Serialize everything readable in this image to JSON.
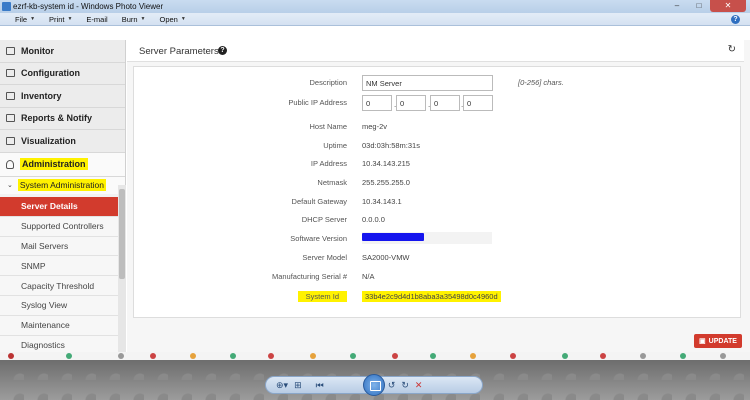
{
  "window": {
    "title": "ezrf-kb-system id - Windows Photo Viewer",
    "controls": [
      "–",
      "□",
      "✕"
    ]
  },
  "menubar": {
    "items": [
      {
        "label": "File",
        "caret": true
      },
      {
        "label": "Print",
        "caret": true
      },
      {
        "label": "E-mail",
        "caret": false
      },
      {
        "label": "Burn",
        "caret": true
      },
      {
        "label": "Open",
        "caret": true
      }
    ],
    "help_icon": "?"
  },
  "sidebar": {
    "items": [
      {
        "label": "Monitor",
        "icon": "monitor-icon"
      },
      {
        "label": "Configuration",
        "icon": "folder-icon"
      },
      {
        "label": "Inventory",
        "icon": "folder-icon"
      },
      {
        "label": "Reports & Notify",
        "icon": "folder-icon"
      },
      {
        "label": "Visualization",
        "icon": "monitor-icon"
      }
    ],
    "administration": {
      "label": "Administration",
      "icon": "person-icon"
    },
    "system_administration": {
      "label": "System Administration",
      "chevron": "⌄"
    },
    "sub_items": [
      {
        "label": "Server Details",
        "active": true
      },
      {
        "label": "Supported Controllers"
      },
      {
        "label": "Mail Servers"
      },
      {
        "label": "SNMP"
      },
      {
        "label": "Capacity Threshold"
      },
      {
        "label": "Syslog View"
      },
      {
        "label": "Maintenance"
      },
      {
        "label": "Diagnostics"
      }
    ]
  },
  "panel": {
    "title": "Server Parameters",
    "help": "?",
    "refresh": "↻"
  },
  "form": {
    "description_label": "Description",
    "description_value": "NM Server",
    "description_hint": "[0-256] chars.",
    "public_ip_label": "Public IP Address",
    "public_ip": [
      "0",
      "0",
      "0",
      "0"
    ],
    "ip_sep": ".",
    "host_name_label": "Host Name",
    "host_name": "meg-2v",
    "uptime_label": "Uptime",
    "uptime": "03d:03h:58m:31s",
    "ip_address_label": "IP Address",
    "ip_address": "10.34.143.215",
    "netmask_label": "Netmask",
    "netmask": "255.255.255.0",
    "gateway_label": "Default Gateway",
    "gateway": "10.34.143.1",
    "dhcp_label": "DHCP Server",
    "dhcp": "0.0.0.0",
    "software_version_label": "Software Version",
    "server_model_label": "Server Model",
    "server_model": "SA2000-VMW",
    "serial_label": "Manufacturing Serial #",
    "serial": "N/A",
    "system_id_label": "System Id",
    "system_id": "33b4e2c9d4d1b8aba3a35498d0c4960d"
  },
  "update_button": {
    "label": "UPDATE",
    "icon": "save-icon"
  },
  "colors": {
    "accent_red": "#d23b2d",
    "highlight_yellow": "#fff200",
    "redaction_blue": "#1515ee"
  },
  "photo_viewer_controls": [
    "zoom-icon",
    "fit-icon",
    "previous-icon",
    "slideshow-icon",
    "next-icon",
    "rotate-left-icon",
    "rotate-right-icon",
    "delete-icon"
  ]
}
